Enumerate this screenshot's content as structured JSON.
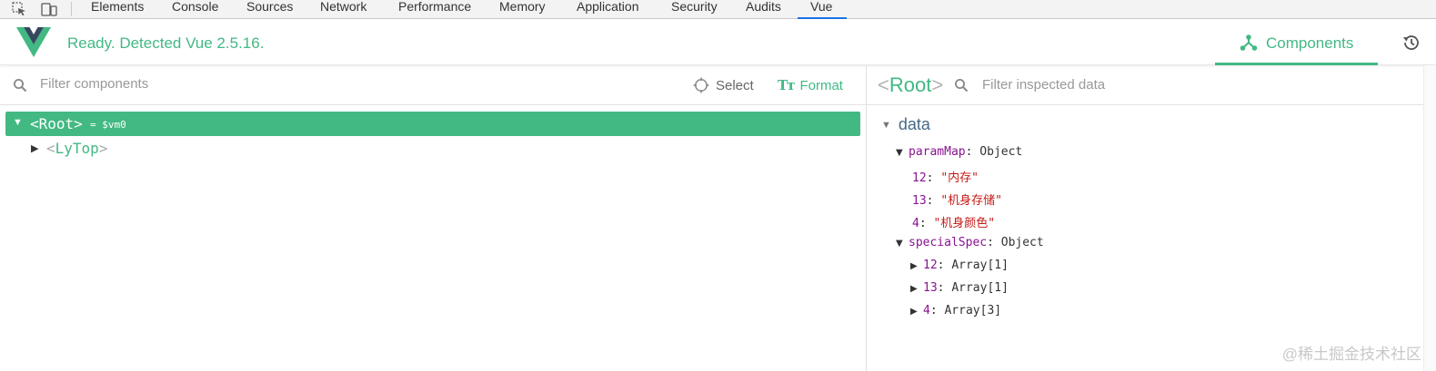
{
  "devtools": {
    "tabs": [
      "Elements",
      "Console",
      "Sources",
      "Network",
      "Performance",
      "Memory",
      "Application",
      "Security",
      "Audits",
      "Vue"
    ],
    "active_tab": "Vue"
  },
  "header": {
    "status": "Ready. Detected Vue 2.5.16.",
    "components_label": "Components"
  },
  "left": {
    "filter_placeholder": "Filter components",
    "select_label": "Select",
    "format_label": "Format",
    "format_icon": "Tт",
    "tree": {
      "root": {
        "arrow": "▼",
        "open": "<",
        "name": "Root",
        "close": ">",
        "vm": "= $vm0"
      },
      "child": {
        "arrow": "▶",
        "open": "<",
        "name": "LyTop",
        "close": ">"
      }
    }
  },
  "right": {
    "inspected": {
      "open": "<",
      "name": "Root",
      "close": ">"
    },
    "filter_placeholder": "Filter inspected data",
    "section": "data",
    "section_arrow": "▼",
    "props": [
      {
        "arrow": "▼",
        "key": "paramMap",
        "sep": ": ",
        "value": "Object",
        "value_type": "plain"
      },
      {
        "arrow": "",
        "key": "12",
        "sep": ": ",
        "value": "\"内存\"",
        "value_type": "string"
      },
      {
        "arrow": "",
        "key": "13",
        "sep": ": ",
        "value": "\"机身存储\"",
        "value_type": "string"
      },
      {
        "arrow": "",
        "key": "4",
        "sep": ": ",
        "value": "\"机身颜色\"",
        "value_type": "string"
      },
      {
        "arrow": "▼",
        "key": "specialSpec",
        "sep": ": ",
        "value": "Object",
        "value_type": "plain"
      },
      {
        "arrow": "▶",
        "key": "12",
        "sep": ": ",
        "value": "Array[1]",
        "value_type": "plain"
      },
      {
        "arrow": "▶",
        "key": "13",
        "sep": ": ",
        "value": "Array[1]",
        "value_type": "plain"
      },
      {
        "arrow": "▶",
        "key": "4",
        "sep": ": ",
        "value": "Array[3]",
        "value_type": "plain"
      }
    ]
  },
  "watermark": "@稀土掘金技术社区",
  "colors": {
    "accent": "#42b983",
    "key": "#881391",
    "string": "#c41a16",
    "section": "#486887"
  }
}
